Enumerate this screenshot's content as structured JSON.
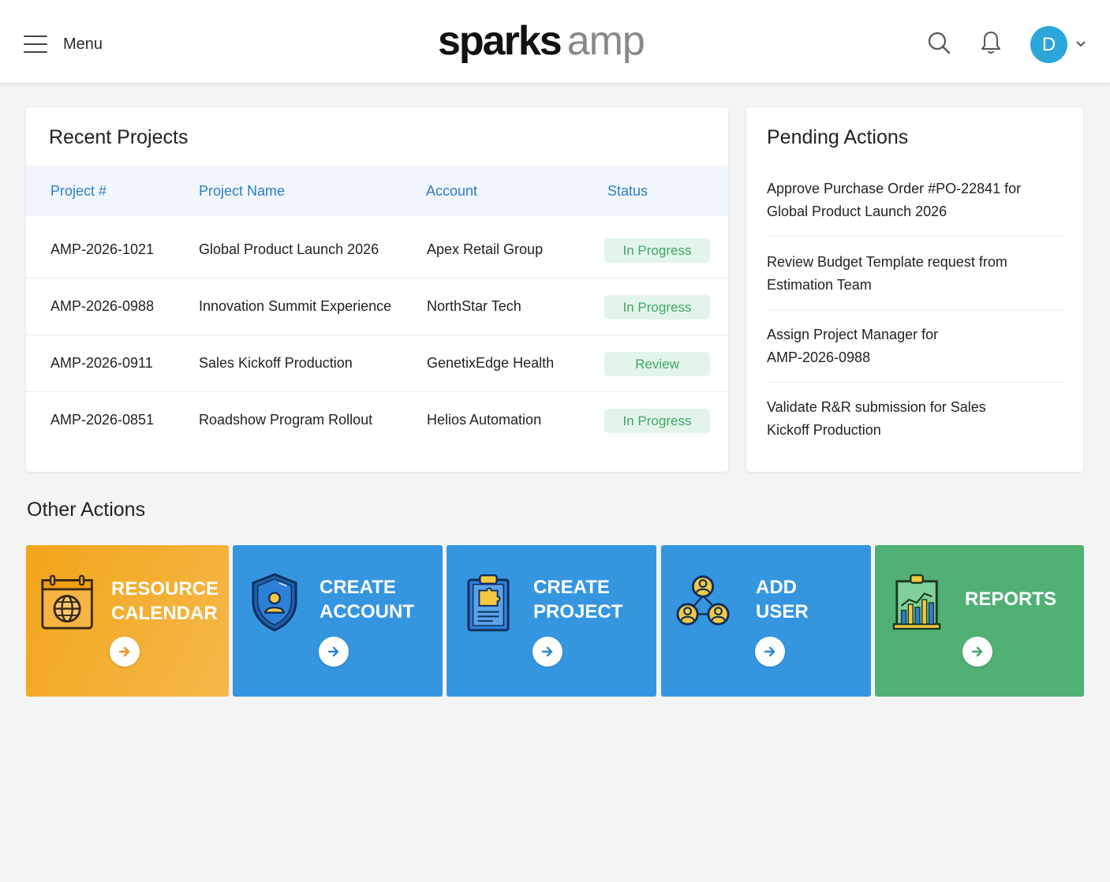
{
  "header": {
    "menu_label": "Menu",
    "logo_bold": "sparks",
    "logo_light": "amp",
    "avatar_initial": "D",
    "icons": [
      "menu-icon",
      "search-icon",
      "bell-icon",
      "chevron-down-icon"
    ],
    "avatar_color": "#2ba6d9"
  },
  "recent_projects": {
    "title": "Recent Projects",
    "columns": [
      "Project #",
      "Project Name",
      "Account",
      "Status"
    ],
    "rows": [
      {
        "number": "AMP-2026-1021",
        "name": "Global Product Launch 2026",
        "account": "Apex Retail Group",
        "status": "In Progress"
      },
      {
        "number": "AMP-2026-0988",
        "name": "Innovation Summit Experience",
        "account": "NorthStar Tech",
        "status": "In Progress"
      },
      {
        "number": "AMP-2026-0911",
        "name": "Sales Kickoff Production",
        "account": "GenetixEdge Health",
        "status": "Review"
      },
      {
        "number": "AMP-2026-0851",
        "name": "Roadshow Program Rollout",
        "account": "Helios Automation",
        "status": "In Progress"
      }
    ]
  },
  "pending_actions": {
    "title": "Pending Actions",
    "items": [
      {
        "line1": "Approve Purchase Order #PO-22841 for",
        "line2": "Global Product Launch 2026"
      },
      {
        "line1": "Review Budget Template request from",
        "line2": "Estimation Team"
      },
      {
        "line1": "Assign Project Manager for",
        "line2": "AMP-2026-0988"
      },
      {
        "line1": "Validate R&R submission for Sales",
        "line2": "Kickoff Production"
      }
    ]
  },
  "other_actions": {
    "title": "Other Actions",
    "tiles": [
      {
        "line1": "RESOURCE",
        "line2": "CALENDAR",
        "icon": "calendar-globe-icon",
        "color": "#f2a51a"
      },
      {
        "line1": "CREATE",
        "line2": "ACCOUNT",
        "icon": "shield-user-icon",
        "color": "#3596df"
      },
      {
        "line1": "CREATE",
        "line2": "PROJECT",
        "icon": "clipboard-puzzle-icon",
        "color": "#3596df"
      },
      {
        "line1": "ADD",
        "line2": "USER",
        "icon": "user-group-icon",
        "color": "#3596df"
      },
      {
        "line1": "REPORTS",
        "line2": "",
        "icon": "bar-chart-icon",
        "color": "#51b074"
      }
    ]
  },
  "colors": {
    "status_badge_bg": "#e3f4ea",
    "status_badge_text": "#3fa865",
    "table_header_text": "#2f7ec4"
  }
}
